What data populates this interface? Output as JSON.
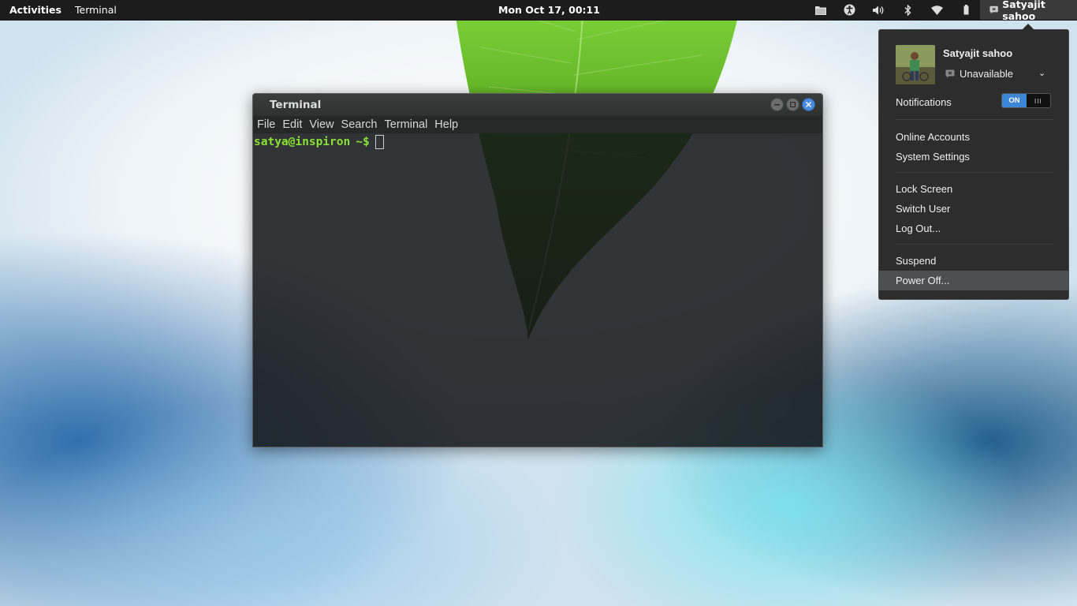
{
  "topbar": {
    "activities": "Activities",
    "app_menu": "Terminal",
    "clock": "Mon Oct 17, 00:11",
    "tray_icons": [
      "folder-icon",
      "accessibility-icon",
      "volume-icon",
      "bluetooth-icon",
      "wifi-icon",
      "battery-icon"
    ],
    "user_name": "Satyajit sahoo"
  },
  "terminal": {
    "title": "Terminal",
    "menu": [
      "File",
      "Edit",
      "View",
      "Search",
      "Terminal",
      "Help"
    ],
    "prompt_user_host": "satya@inspiron",
    "prompt_symbol": "~$"
  },
  "user_menu": {
    "name": "Satyajit sahoo",
    "status": "Unavailable",
    "notifications_label": "Notifications",
    "notifications_toggle": "ON",
    "items_group1": [
      "Online Accounts",
      "System Settings"
    ],
    "items_group2": [
      "Lock Screen",
      "Switch User",
      "Log Out..."
    ],
    "items_group3": [
      "Suspend",
      "Power Off..."
    ]
  },
  "colors": {
    "prompt_green": "#8ae234",
    "toggle_blue": "#3b86d6",
    "close_button_blue": "#4c8be0"
  }
}
